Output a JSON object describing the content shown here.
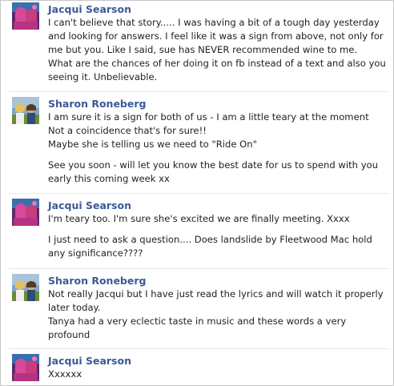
{
  "messages": [
    {
      "author": "Jacqui Searson",
      "avatar_icon": "jacqui-profile-photo",
      "paragraphs": [
        [
          "I can't believe that story..... I was having a bit of a tough day yesterday",
          "and looking for answers.  I feel like it was a sign from above, not only for",
          "me but you. Like I said, sue has NEVER recommended wine to me.",
          "What are the chances of her doing it on fb instead of a text and also you",
          "seeing it. Unbelievable."
        ]
      ]
    },
    {
      "author": "Sharon Roneberg",
      "avatar_icon": "sharon-profile-photo",
      "paragraphs": [
        [
          "I am sure it is a sign for both of us - I am a little teary at the moment",
          "Not a coincidence that's for sure!!",
          "Maybe she is telling us we need to \"Ride On\""
        ],
        [
          "See you soon - will let you know the best date for us to spend with you",
          "early this coming week xx"
        ]
      ]
    },
    {
      "author": "Jacqui Searson",
      "avatar_icon": "jacqui-profile-photo",
      "paragraphs": [
        [
          "I'm teary too. I'm sure she's excited we are finally meeting. Xxxx"
        ],
        [
          "I just need to ask a question.... Does landslide by Fleetwood Mac hold",
          "any significance????"
        ]
      ]
    },
    {
      "author": "Sharon Roneberg",
      "avatar_icon": "sharon-profile-photo",
      "paragraphs": [
        [
          "Not really Jacqui but I have just read the lyrics and will watch it properly",
          "later today.",
          "Tanya had a very eclectic taste in music and these words a very",
          "profound"
        ]
      ]
    },
    {
      "author": "Jacqui Searson",
      "avatar_icon": "jacqui-profile-photo",
      "paragraphs": [
        [
          "Xxxxxx"
        ]
      ]
    }
  ],
  "colors": {
    "author_link": "#3b5998",
    "message_text": "#222222",
    "separator": "#e9e9e9"
  }
}
